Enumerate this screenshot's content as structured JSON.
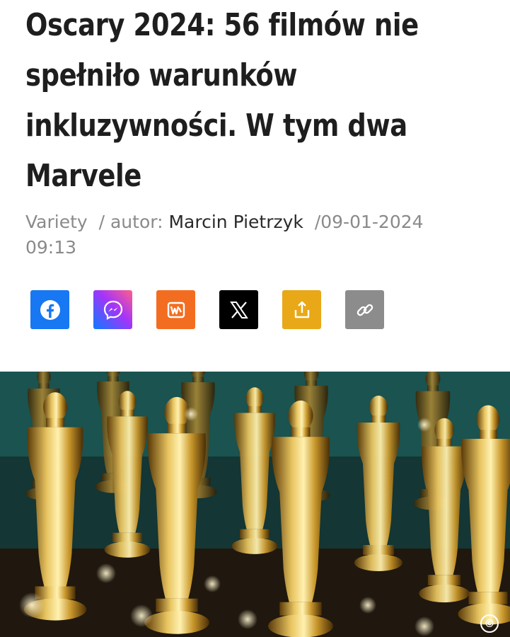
{
  "article": {
    "title_lines": [
      "Oscary 2024: 56 filmów nie",
      "spełniło warunków",
      "inkluzywności. W tym dwa",
      "Marvele"
    ],
    "source": "Variety",
    "author_prefix": "autor:",
    "author_name": "Marcin Pietrzyk",
    "date": "09-01-2024",
    "time": "09:13",
    "separator": "/"
  },
  "share": {
    "buttons": [
      {
        "name": "facebook",
        "icon": "facebook-icon",
        "color": "#1877f2"
      },
      {
        "name": "messenger",
        "icon": "messenger-icon",
        "color": "#a646f0"
      },
      {
        "name": "wykop",
        "icon": "wykop-icon",
        "color": "#f36d21"
      },
      {
        "name": "x",
        "icon": "x-icon",
        "color": "#000000"
      },
      {
        "name": "share",
        "icon": "share-icon",
        "color": "#e8a817"
      },
      {
        "name": "copy-link",
        "icon": "link-icon",
        "color": "#8c8c8c"
      }
    ]
  },
  "hero": {
    "subject": "oscar-statuettes",
    "copyright_mark": "©"
  }
}
